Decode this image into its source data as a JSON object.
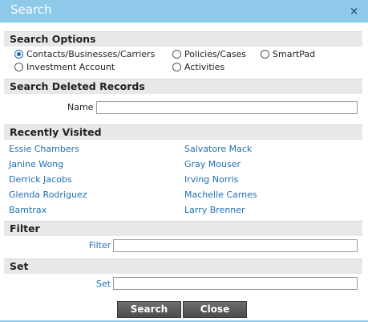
{
  "dialog": {
    "title": "Search",
    "close_glyph": "×"
  },
  "search_options": {
    "header": "Search Options",
    "options": [
      {
        "label": "Contacts/Businesses/Carriers",
        "selected": true
      },
      {
        "label": "Policies/Cases",
        "selected": false
      },
      {
        "label": "SmartPad",
        "selected": false
      },
      {
        "label": "Investment Account",
        "selected": false
      },
      {
        "label": "Activities",
        "selected": false
      }
    ]
  },
  "deleted_records": {
    "header": "Search Deleted Records",
    "name_label": "Name",
    "name_value": ""
  },
  "recently_visited": {
    "header": "Recently Visited",
    "left": [
      "Essie Chambers",
      "Janine Wong",
      "Derrick Jacobs",
      "Glenda Rodriguez",
      "Bamtrax"
    ],
    "right": [
      "Salvatore Mack",
      "Gray Mouser",
      "Irving Norris",
      "Machelle Carnes",
      "Larry Brenner"
    ]
  },
  "filter": {
    "header": "Filter",
    "label": "Filter",
    "value": ""
  },
  "set": {
    "header": "Set",
    "label": "Set",
    "value": ""
  },
  "buttons": {
    "search": "Search",
    "close": "Close"
  },
  "colors": {
    "titlebar": "#8ec9ea",
    "link": "#1f6fb5",
    "section_bg": "#e8e8e8",
    "button": "#5a5a5a"
  }
}
